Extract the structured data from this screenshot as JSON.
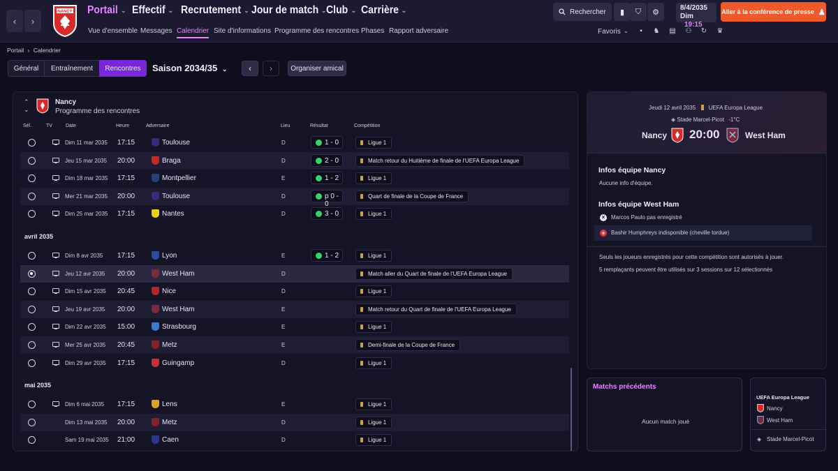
{
  "nav": {
    "main": [
      {
        "label": "Portail",
        "active": true
      },
      {
        "label": "Effectif"
      },
      {
        "label": "Recrutement"
      },
      {
        "label": "Jour de match"
      },
      {
        "label": "Club"
      },
      {
        "label": "Carrière"
      }
    ],
    "sub": [
      "Vue d'ensemble",
      "Messages",
      "Calendrier",
      "Site d'informations",
      "Programme des rencontres",
      "Phases",
      "Rapport adversaire"
    ],
    "sub_active": "Calendrier",
    "search_label": "Rechercher",
    "date_line1": "8/4/2035",
    "date_day": "Dim",
    "date_time": "19:15",
    "press_label": "Aller à la conférence de presse",
    "favorites_label": "Favoris",
    "club_short": "NANCY"
  },
  "breadcrumb": {
    "root": "Portail",
    "current": "Calendrier"
  },
  "tabs": [
    "Général",
    "Entraînement",
    "Rencontres"
  ],
  "active_tab": "Rencontres",
  "season_label": "Saison 2034/35",
  "friendly_label": "Organiser amical",
  "fixtures": {
    "team": "Nancy",
    "subtitle": "Programme des rencontres",
    "columns": {
      "sel": "Sél.",
      "tv": "TV",
      "date": "Date",
      "time": "Heure",
      "opponent": "Adversaire",
      "venue": "Lieu",
      "result": "Résultat",
      "competition": "Compétition"
    },
    "months": [
      {
        "label": "",
        "rows": [
          {
            "date": "Dim 11 mar 2035",
            "time": "17:15",
            "opponent": "Toulouse",
            "venue": "D",
            "result": "1 - 0",
            "competition": "Ligue 1",
            "crest": "#3b2a7a",
            "tv": true
          },
          {
            "date": "Jeu 15 mar 2035",
            "time": "20:00",
            "opponent": "Braga",
            "venue": "D",
            "result": "2 - 0",
            "competition": "Match retour du Huitième de finale de l'UEFA Europa League",
            "crest": "#c22a2a",
            "tv": true
          },
          {
            "date": "Dim 18 mar 2035",
            "time": "17:15",
            "opponent": "Montpellier",
            "venue": "E",
            "result": "1 - 2",
            "competition": "Ligue 1",
            "crest": "#27407f",
            "tv": true
          },
          {
            "date": "Mer 21 mar 2035",
            "time": "20:00",
            "opponent": "Toulouse",
            "venue": "D",
            "result": "p 0 - 0",
            "competition": "Quart de finale de la Coupe de France",
            "crest": "#3b2a7a",
            "tv": true
          },
          {
            "date": "Dim 25 mar 2035",
            "time": "17:15",
            "opponent": "Nantes",
            "venue": "D",
            "result": "3 - 0",
            "competition": "Ligue 1",
            "crest": "#e8d20f",
            "tv": true
          }
        ]
      },
      {
        "label": "avril 2035",
        "rows": [
          {
            "date": "Dim 8 avr 2035",
            "time": "17:15",
            "opponent": "Lyon",
            "venue": "E",
            "result": "1 - 2",
            "competition": "Ligue 1",
            "crest": "#2a4aa0",
            "tv": true
          },
          {
            "date": "Jeu 12 avr 2035",
            "time": "20:00",
            "opponent": "West Ham",
            "venue": "D",
            "result": "",
            "competition": "Match aller du Quart de finale de l'UEFA Europa League",
            "crest": "#7a2a3a",
            "tv": true,
            "selected": true
          },
          {
            "date": "Dim 15 avr 2035",
            "time": "20:45",
            "opponent": "Nice",
            "venue": "D",
            "result": "",
            "competition": "Ligue 1",
            "crest": "#b8242a",
            "tv": true
          },
          {
            "date": "Jeu 19 avr 2035",
            "time": "20:00",
            "opponent": "West Ham",
            "venue": "E",
            "result": "",
            "competition": "Match retour du Quart de finale de l'UEFA Europa League",
            "crest": "#7a2a3a",
            "tv": true
          },
          {
            "date": "Dim 22 avr 2035",
            "time": "15:00",
            "opponent": "Strasbourg",
            "venue": "E",
            "result": "",
            "competition": "Ligue 1",
            "crest": "#3a7ad0",
            "tv": true
          },
          {
            "date": "Mer 25 avr 2035",
            "time": "20:45",
            "opponent": "Metz",
            "venue": "E",
            "result": "",
            "competition": "Demi-finale de la Coupe de France",
            "crest": "#8a1f2a",
            "tv": true
          },
          {
            "date": "Dim 29 avr 2035",
            "time": "17:15",
            "opponent": "Guingamp",
            "venue": "D",
            "result": "",
            "competition": "Ligue 1",
            "crest": "#c4303a",
            "tv": true
          }
        ]
      },
      {
        "label": "mai 2035",
        "rows": [
          {
            "date": "Dim 6 mai 2035",
            "time": "17:15",
            "opponent": "Lens",
            "venue": "E",
            "result": "",
            "competition": "Ligue 1",
            "crest": "#d8a520",
            "tv": true
          },
          {
            "date": "Dim 13 mai 2035",
            "time": "20:00",
            "opponent": "Metz",
            "venue": "D",
            "result": "",
            "competition": "Ligue 1",
            "crest": "#8a1f2a",
            "tv": false
          },
          {
            "date": "Sam 19 mai 2035",
            "time": "21:00",
            "opponent": "Caen",
            "venue": "D",
            "result": "",
            "competition": "Ligue 1",
            "crest": "#2a3a8a",
            "tv": false
          }
        ]
      }
    ]
  },
  "match": {
    "date": "Jeudi 12 avril 2035",
    "competition": "UEFA Europa League",
    "stadium": "Stade Marcel-Picot",
    "temp": "-1°C",
    "home": "Nancy",
    "away": "West Ham",
    "kickoff": "20:00",
    "home_title": "Infos équipe Nancy",
    "home_info": "Aucune info d'équipe.",
    "away_title": "Infos équipe West Ham",
    "away_info": [
      {
        "text": "Marcos Paulo pas enregistré",
        "kind": "not-registered"
      },
      {
        "text": "Bashir Humphreys indisponible (cheville tordue)",
        "kind": "injured"
      }
    ],
    "note1": "Seuls les joueurs enregistrés pour cette compétition sont autorisés à jouer.",
    "note2": "5 remplaçants peuvent être utilisés sur 3 sessions sur 12 sélectionnés"
  },
  "previous": {
    "title": "Matchs précédents",
    "empty": "Aucun match joué"
  },
  "mini": {
    "competition": "UEFA Europa League",
    "home": "Nancy",
    "away": "West Ham",
    "stadium": "Stade Marcel-Picot"
  },
  "colors": {
    "accent": "#e784ff",
    "tab_active": "#7928d9",
    "press": "#ee5a2c",
    "win": "#3ad06b"
  }
}
